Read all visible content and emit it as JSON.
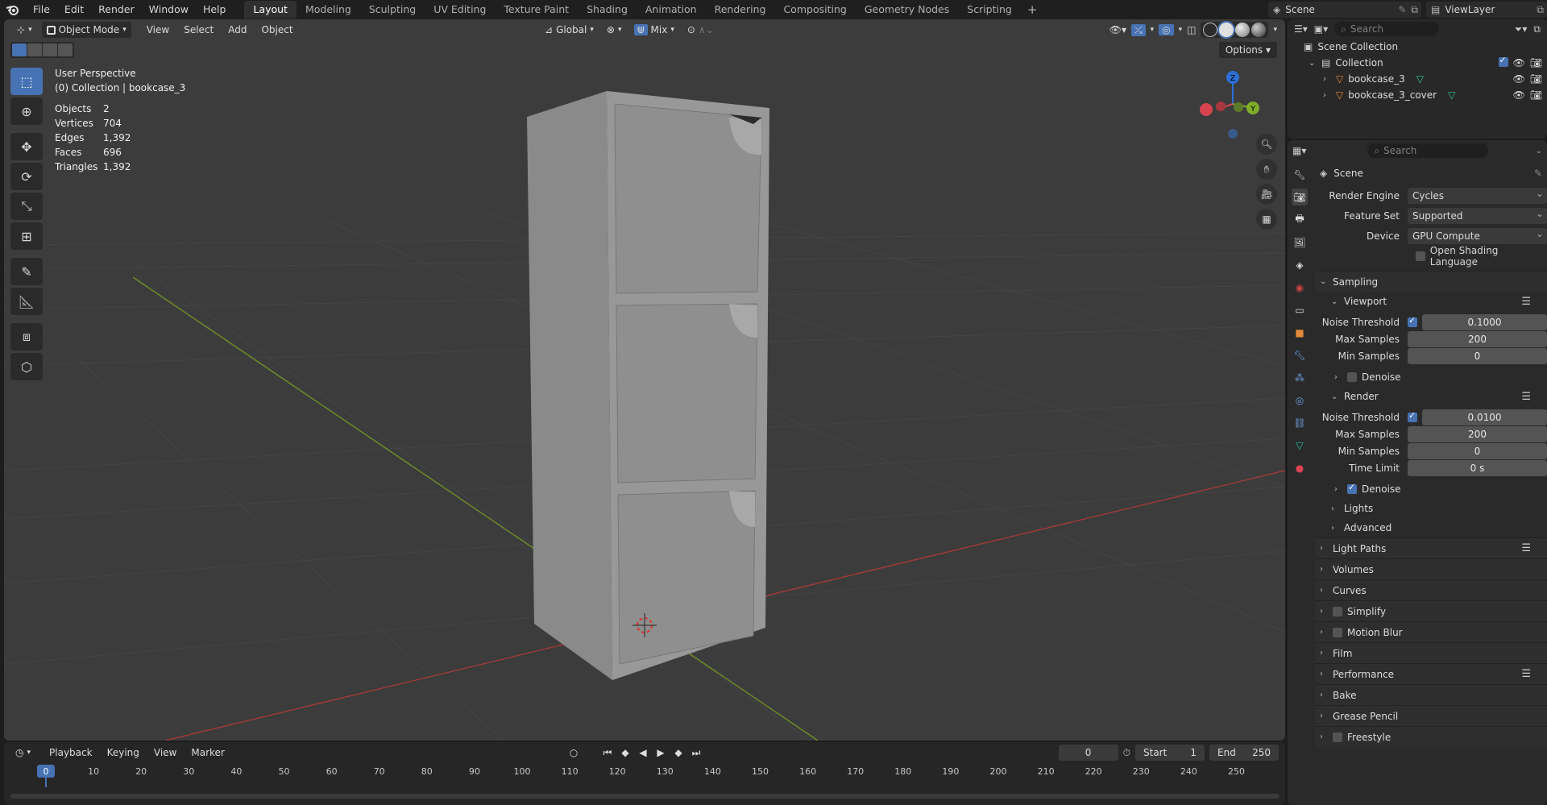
{
  "topbar": {
    "menus": [
      "File",
      "Edit",
      "Render",
      "Window",
      "Help"
    ],
    "workspaces": [
      "Layout",
      "Modeling",
      "Sculpting",
      "UV Editing",
      "Texture Paint",
      "Shading",
      "Animation",
      "Rendering",
      "Compositing",
      "Geometry Nodes",
      "Scripting"
    ],
    "active_workspace": "Layout",
    "scene_name": "Scene",
    "view_layer": "ViewLayer"
  },
  "viewport": {
    "mode": "Object Mode",
    "menus": [
      "View",
      "Select",
      "Add",
      "Object"
    ],
    "orientation": "Global",
    "snap_mode": "Mix",
    "options_label": "Options",
    "overlay": {
      "perspective": "User Perspective",
      "collection": "(0) Collection | bookcase_3",
      "stats": [
        {
          "key": "Objects",
          "value": "2"
        },
        {
          "key": "Vertices",
          "value": "704"
        },
        {
          "key": "Edges",
          "value": "1,392"
        },
        {
          "key": "Faces",
          "value": "696"
        },
        {
          "key": "Triangles",
          "value": "1,392"
        }
      ]
    },
    "gizmo_axes": {
      "x": "X",
      "y": "Y",
      "z": "Z"
    }
  },
  "timeline": {
    "menus": [
      "Playback",
      "Keying",
      "View",
      "Marker"
    ],
    "current_frame": "0",
    "start_label": "Start",
    "start": "1",
    "end_label": "End",
    "end": "250",
    "ticks": [
      "0",
      "10",
      "20",
      "30",
      "40",
      "50",
      "60",
      "70",
      "80",
      "90",
      "100",
      "110",
      "120",
      "130",
      "140",
      "150",
      "160",
      "170",
      "180",
      "190",
      "200",
      "210",
      "220",
      "230",
      "240",
      "250"
    ]
  },
  "outliner": {
    "search_placeholder": "Search",
    "root": "Scene Collection",
    "collection": "Collection",
    "items": [
      "bookcase_3",
      "bookcase_3_cover"
    ]
  },
  "properties": {
    "search_placeholder": "Search",
    "context": "Scene",
    "render_engine_label": "Render Engine",
    "render_engine": "Cycles",
    "feature_set_label": "Feature Set",
    "feature_set": "Supported",
    "device_label": "Device",
    "device": "GPU Compute",
    "osl_label": "Open Shading Language",
    "sampling": {
      "title": "Sampling",
      "viewport": {
        "title": "Viewport",
        "noise_threshold_label": "Noise Threshold",
        "noise_threshold": "0.1000",
        "max_samples_label": "Max Samples",
        "max_samples": "200",
        "min_samples_label": "Min Samples",
        "min_samples": "0",
        "denoise_label": "Denoise"
      },
      "render": {
        "title": "Render",
        "noise_threshold_label": "Noise Threshold",
        "noise_threshold": "0.0100",
        "max_samples_label": "Max Samples",
        "max_samples": "200",
        "min_samples_label": "Min Samples",
        "min_samples": "0",
        "time_limit_label": "Time Limit",
        "time_limit": "0 s",
        "denoise_label": "Denoise"
      },
      "lights_label": "Lights",
      "advanced_label": "Advanced"
    },
    "panels": [
      "Light Paths",
      "Volumes",
      "Curves",
      "Simplify",
      "Motion Blur",
      "Film",
      "Performance",
      "Bake",
      "Grease Pencil",
      "Freestyle"
    ]
  }
}
